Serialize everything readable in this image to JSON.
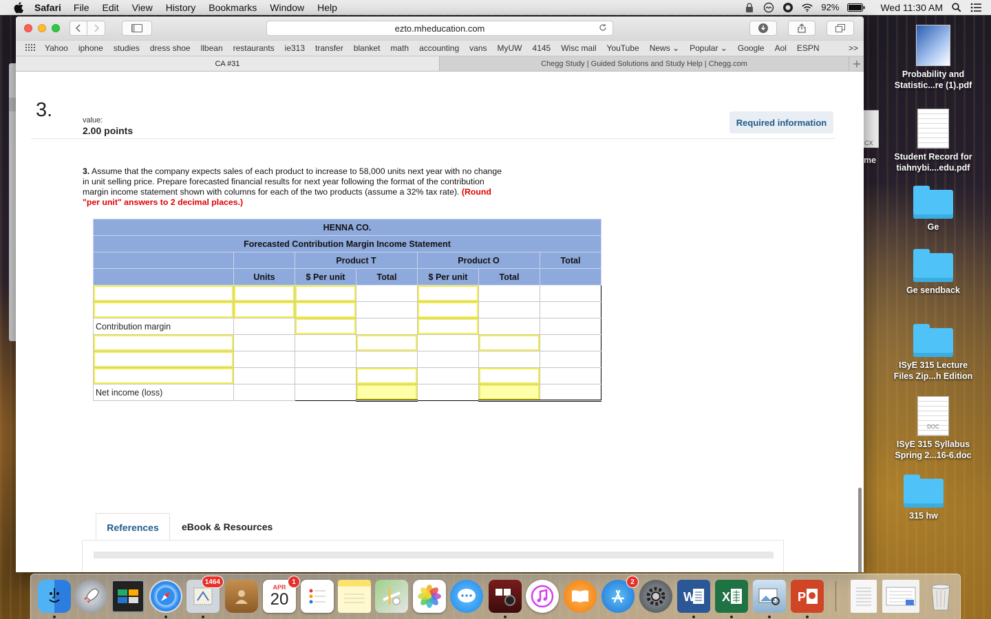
{
  "menubar": {
    "app_name": "Safari",
    "items": [
      "File",
      "Edit",
      "View",
      "History",
      "Bookmarks",
      "Window",
      "Help"
    ],
    "battery": "92%",
    "clock": "Wed 11:30 AM"
  },
  "browser": {
    "url": "ezto.mheducation.com",
    "bookmarks": [
      "Yahoo",
      "iphone",
      "studies",
      "dress shoe",
      "llbean",
      "restaurants",
      "ie313",
      "transfer",
      "blanket",
      "math",
      "accounting",
      "vans",
      "MyUW",
      "4145",
      "Wisc mail",
      "YouTube",
      "News ⌄",
      "Popular ⌄",
      "Google",
      "Aol",
      "ESPN"
    ],
    "bookmarks_overflow": ">>",
    "tabs": [
      {
        "label": "CA #31",
        "active": true
      },
      {
        "label": "Chegg Study | Guided Solutions and Study Help | Chegg.com",
        "active": false
      }
    ]
  },
  "question": {
    "number": "3.",
    "value_label": "value:",
    "value": "2.00 points",
    "required_info": "Required information",
    "number_inline": "3.",
    "text": " Assume that the company expects sales of each product to increase to 58,000 units next year with no change in unit selling price. Prepare forecasted financial results for next year following the format of the contribution margin income statement shown with columns for each of the two products (assume a 32% tax rate). ",
    "note": "(Round \"per unit\" answers to 2 decimal places.)"
  },
  "statement": {
    "company": "HENNA CO.",
    "title": "Forecasted Contribution Margin Income Statement",
    "product_t": "Product T",
    "product_o": "Product O",
    "total": "Total",
    "units": "Units",
    "per_unit_t": "$ Per unit",
    "total_t": "Total",
    "per_unit_o": "$ Per unit",
    "total_o": "Total",
    "contribution_margin": "Contribution margin",
    "net_income": "Net income (loss)"
  },
  "resources": {
    "tab_references": "References",
    "tab_ebook": "eBook & Resources"
  },
  "desktop": {
    "icons": [
      {
        "label": "Probability and Statistic...re (1).pdf",
        "type": "pdf"
      },
      {
        "label": "Student Record for tiahnybi....edu.pdf",
        "type": "pdf"
      },
      {
        "label": "Ge",
        "type": "folder"
      },
      {
        "label": "Ge sendback",
        "type": "folder"
      },
      {
        "label": "ISyE 315 Lecture Files Zip...h Edition",
        "type": "folder"
      },
      {
        "label": "ISyE 315 Syllabus Spring 2...16-6.doc",
        "type": "doc",
        "tag": "DOC"
      },
      {
        "label": "315 hw",
        "type": "folder"
      }
    ],
    "partial_label": "me",
    "partial_tag": "CX"
  },
  "dock": {
    "mail_badge": "1464",
    "calendar_month": "APR",
    "calendar_day": "20",
    "calendar_badge": "1",
    "appstore_badge": "2"
  }
}
